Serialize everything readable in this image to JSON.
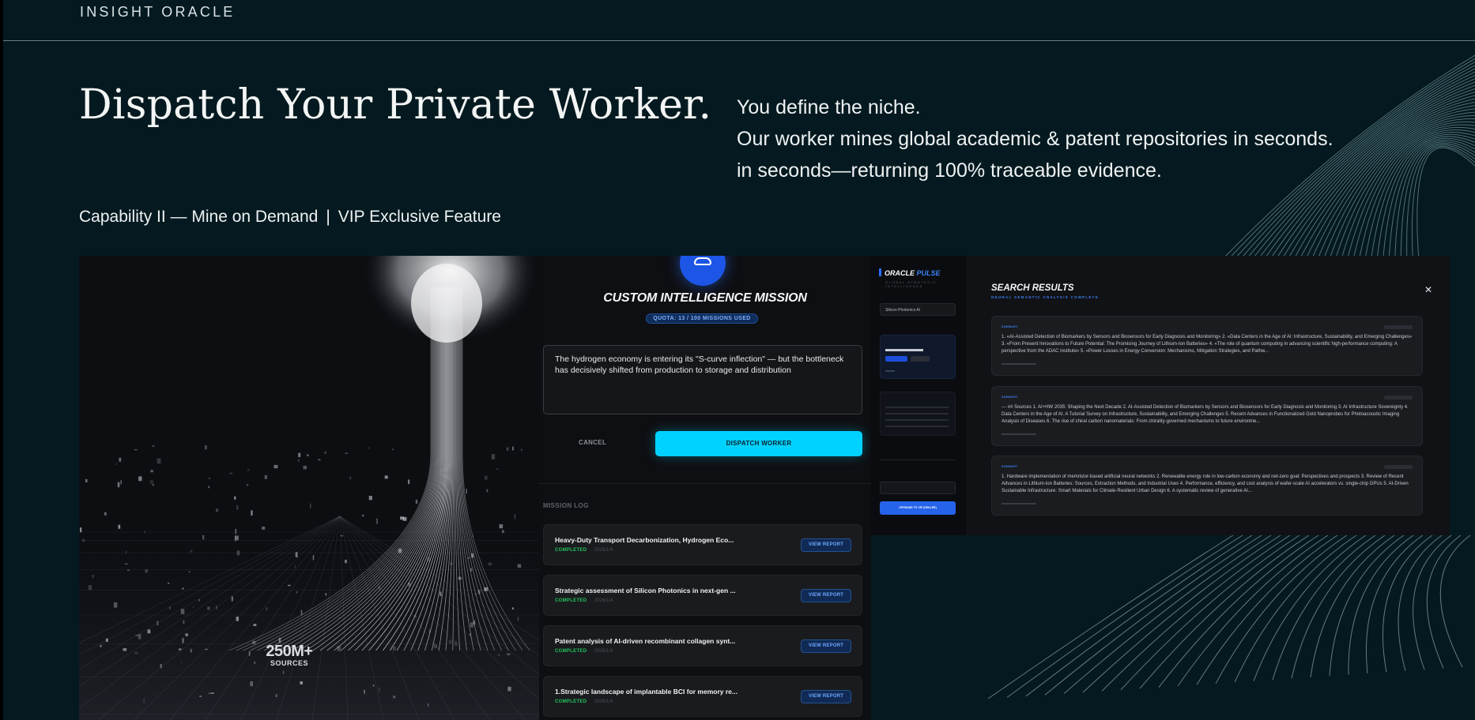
{
  "page": {
    "brand": "INSIGHT ORACLE",
    "headline": "Dispatch Your Private Worker.",
    "lead": [
      "You define the niche.",
      "Our worker mines global academic & patent repositories in seconds.",
      "in seconds—returning 100% traceable evidence."
    ],
    "capability": "Capability II — Mine on Demand",
    "capability_sep": "|",
    "feature": "VIP Exclusive Feature"
  },
  "hero": {
    "stat": "250M+",
    "stat_label": "SOURCES"
  },
  "mission": {
    "title": "CUSTOM INTELLIGENCE MISSION",
    "quota": "QUOTA: 13 / 100 MISSIONS USED",
    "prompt": "The hydrogen economy is entering its \"S-curve inflection\" — but the bottleneck has decisively shifted from production to storage and distribution",
    "cancel_label": "CANCEL",
    "dispatch_label": "DISPATCH WORKER",
    "log_title": "MISSION LOG",
    "log": [
      {
        "name": "Heavy-Duty Transport Decarbonization, Hydrogen Eco...",
        "status": "COMPLETED",
        "date": "2026/1/4",
        "action": "VIEW REPORT"
      },
      {
        "name": "Strategic assessment of Silicon Photonics in next-gen ...",
        "status": "COMPLETED",
        "date": "2026/1/4",
        "action": "VIEW REPORT"
      },
      {
        "name": "Patent analysis of AI-driven recombinant collagen synt...",
        "status": "COMPLETED",
        "date": "2026/1/4",
        "action": "VIEW REPORT"
      },
      {
        "name": "1.Strategic landscape of implantable BCI for memory re...",
        "status": "COMPLETED",
        "date": "2026/1/4",
        "action": "VIEW REPORT"
      }
    ]
  },
  "sidebar": {
    "logo_main": "ORACLE",
    "logo_accent": "PULSE",
    "subtitle": "GLOBAL STRATEGIC INTELLIGENCE",
    "field": "Silicon Photonics AI",
    "upgrade_label": "UPGRADE TO VIP (DEALER)"
  },
  "results": {
    "title": "SEARCH RESULTS",
    "subtitle": "NEURAL SEMANTIC ANALYSIS COMPLETE",
    "close_icon": "✕",
    "items": [
      {
        "tag": "SUMMARY",
        "text": "1. «AI-Assisted Detection of Biomarkers by Sensors and Biosensors for Early Diagnosis and Monitoring» 2. «Data Centers in the Age of AI: Infrastructure, Sustainability, and Emerging Challenges» 3. «From Present Innovations to Future Potential: The Promising Journey of Lithium-Ion Batteries» 4. «The role of quantum computing in advancing scientific high-performance computing: A perspective from the ADAC Institute» 5. «Power Losses in Energy Conversion: Mechanisms, Mitigation Strategies, and Pathw..."
      },
      {
        "tag": "SUMMARY",
        "text": "--- ## Sources 1. AI+HW 2035: Shaping the Next Decade 2. AI-Assisted Detection of Biomarkers by Sensors and Biosensors for Early Diagnosis and Monitoring 3. AI Infrastructure Sovereignty 4. Data Centers in the Age of AI. A Tutorial Survey on Infrastructure, Sustainability, and Emerging Challenges 5. Recent Advances in Functionalized Gold Nanoprobes for Photoacoustic Imaging Analysis of Diseases 6. The rise of chiral carbon nanomaterials: From chirality-governed mechanisms to future environme..."
      },
      {
        "tag": "SUMMARY",
        "text": "1. Hardware implementation of memristor-based artificial neural networks 2. Renewable energy role in low-carbon economy and net-zero goal: Perspectives and prospects 3. Review of Recent Advances in Lithium-Ion Batteries: Sources, Extraction Methods, and Industrial Uses 4. Performance, efficiency, and cost analysis of wafer-scale AI accelerators vs. single-chip GPUs 5. AI-Driven Sustainable Infrastructure: Smart Materials for Climate-Resilient Urban Design 6. A systematic review of generative AI..."
      }
    ]
  },
  "colors": {
    "background": "#051a20",
    "accent_cyan": "#00d2ff",
    "accent_blue": "#2563eb",
    "status_green": "#22c55e"
  }
}
